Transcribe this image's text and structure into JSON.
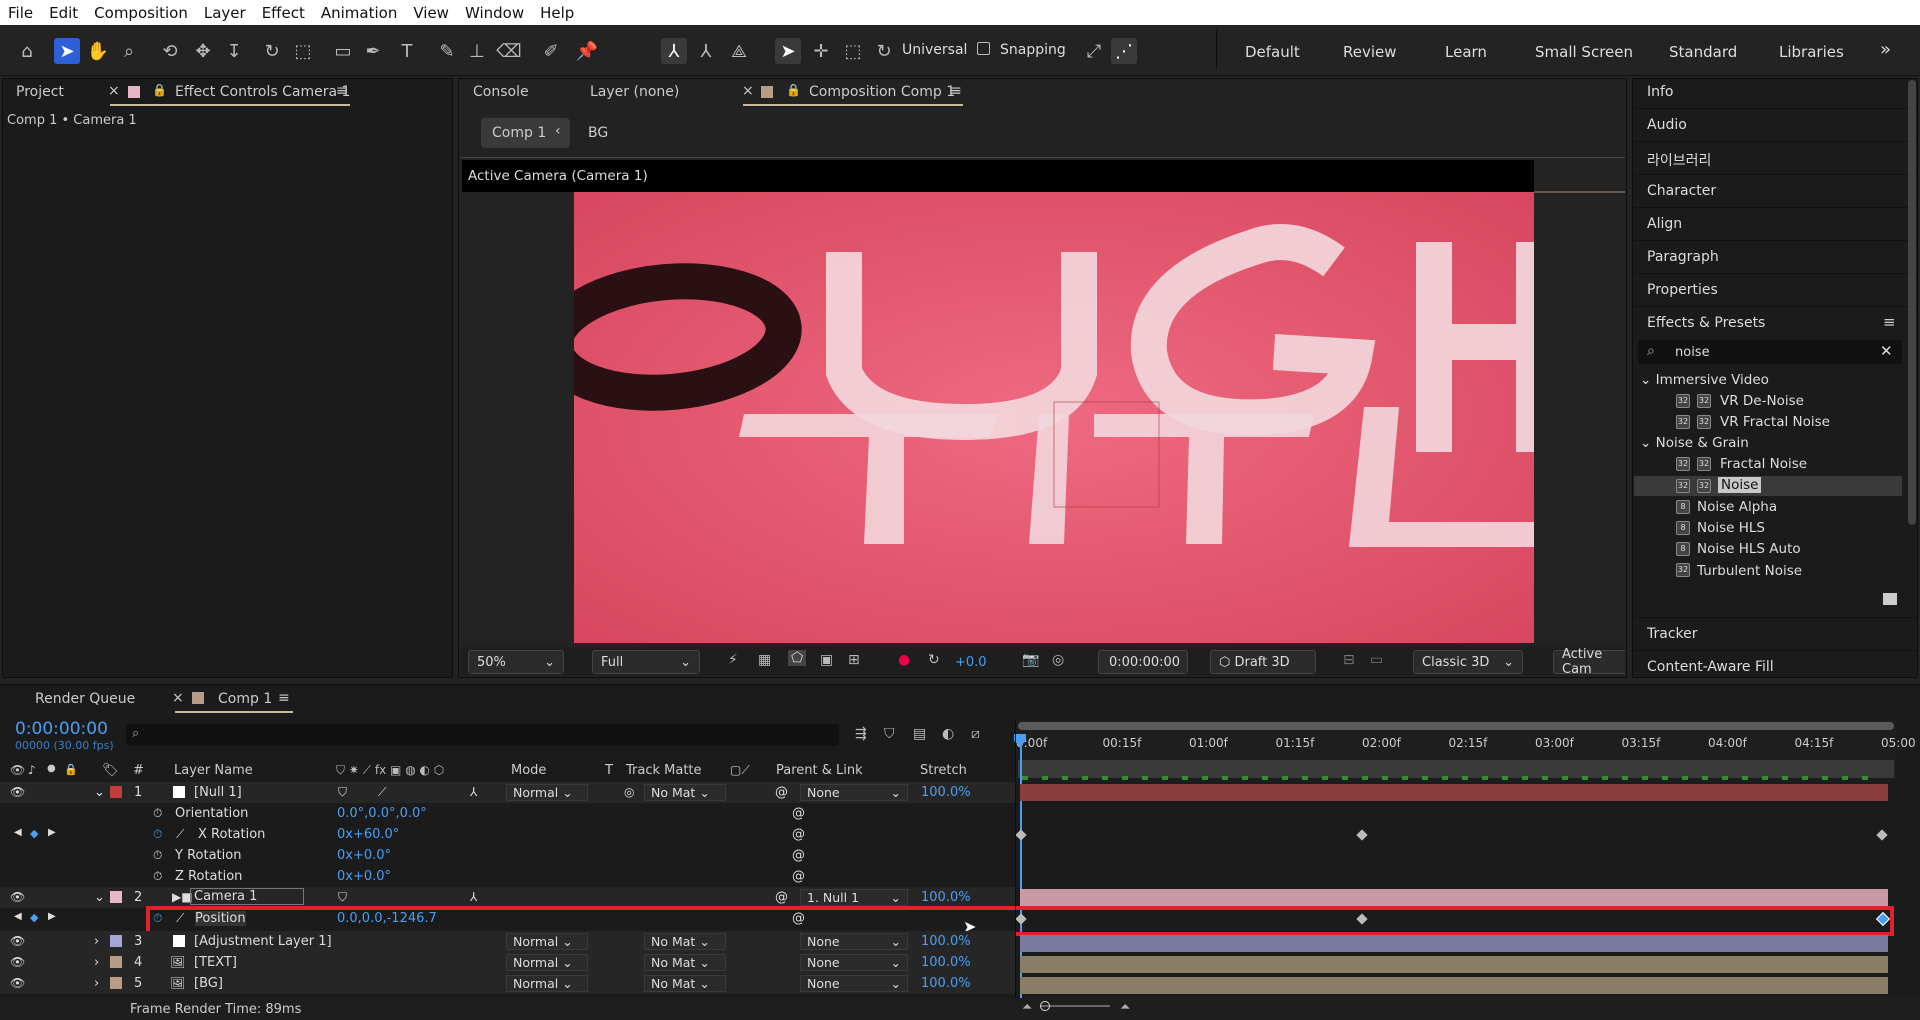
{
  "menu": [
    "File",
    "Edit",
    "Composition",
    "Layer",
    "Effect",
    "Animation",
    "View",
    "Window",
    "Help"
  ],
  "toolbar": {
    "universal": "Universal",
    "snapping": "Snapping"
  },
  "workspaces": [
    "Default",
    "Review",
    "Learn",
    "Small Screen",
    "Standard",
    "Libraries"
  ],
  "left_panel": {
    "tab_project": "Project",
    "tab_effect_controls": "Effect Controls Camera 1",
    "breadcrumb": "Comp 1 • Camera 1"
  },
  "viewer": {
    "tab_console": "Console",
    "tab_layer": "Layer (none)",
    "tab_comp": "Composition Comp 1",
    "comp_chip": "Comp 1",
    "bg_chip": "BG",
    "active_camera": "Active Camera (Camera 1)",
    "zoom": "50%",
    "resolution": "Full",
    "exposure": "+0.0",
    "timecode": "0:00:00:00",
    "draft3d": "Draft 3D",
    "renderer": "Classic 3D",
    "active_cam_btn": "Active Cam"
  },
  "right_panel": {
    "items": [
      "Info",
      "Audio",
      "라이브러리",
      "Character",
      "Align",
      "Paragraph",
      "Properties"
    ],
    "effects_title": "Effects & Presets",
    "search_value": "noise",
    "groups": [
      {
        "name": "Immersive Video",
        "items": [
          "VR De-Noise",
          "VR Fractal Noise"
        ]
      },
      {
        "name": "Noise & Grain",
        "items": [
          "Fractal Noise",
          "Noise",
          "Noise Alpha",
          "Noise HLS",
          "Noise HLS Auto",
          "Turbulent Noise"
        ]
      }
    ],
    "selected_effect": "Noise",
    "tracker": "Tracker",
    "content_aware": "Content-Aware Fill"
  },
  "timeline": {
    "tab_render": "Render Queue",
    "tab_comp": "Comp 1",
    "timecode": "0:00:00:00",
    "fps": "00000 (30.00 fps)",
    "headers": {
      "num": "#",
      "layer_name": "Layer Name",
      "mode": "Mode",
      "t": "T",
      "track_matte": "Track Matte",
      "parent": "Parent & Link",
      "stretch": "Stretch"
    },
    "ruler": [
      "0:00f",
      "00:15f",
      "01:00f",
      "01:15f",
      "02:00f",
      "02:15f",
      "03:00f",
      "03:15f",
      "04:00f",
      "04:15f",
      "05:00"
    ],
    "layers": [
      {
        "num": "1",
        "name": "[Null 1]",
        "mode": "Normal",
        "matte": "No Mat",
        "parent": "None",
        "stretch": "100.0%",
        "color": "#c43b3b"
      },
      {
        "name": "Orientation",
        "value": "0.0°,0.0°,0.0°"
      },
      {
        "name": "X Rotation",
        "value": "0x+60.0°"
      },
      {
        "name": "Y Rotation",
        "value": "0x+0.0°"
      },
      {
        "name": "Z Rotation",
        "value": "0x+0.0°"
      },
      {
        "num": "2",
        "name": "Camera 1",
        "parent": "1. Null 1",
        "stretch": "100.0%",
        "color": "#e8b5c4"
      },
      {
        "name": "Position",
        "value": "0.0,0.0,-1246.7"
      },
      {
        "num": "3",
        "name": "[Adjustment Layer 1]",
        "mode": "Normal",
        "matte": "No Mat",
        "parent": "None",
        "stretch": "100.0%",
        "color": "#a6a6d6"
      },
      {
        "num": "4",
        "name": "[TEXT]",
        "mode": "Normal",
        "matte": "No Mat",
        "parent": "None",
        "stretch": "100.0%",
        "color": "#b89c85"
      },
      {
        "num": "5",
        "name": "[BG]",
        "mode": "Normal",
        "matte": "No Mat",
        "parent": "None",
        "stretch": "100.0%",
        "color": "#b89c85"
      }
    ],
    "footer": "Frame Render Time:",
    "footer_value": "89ms"
  },
  "canvas_text": {
    "line1": "ROUGH",
    "line2": "TITLE"
  }
}
